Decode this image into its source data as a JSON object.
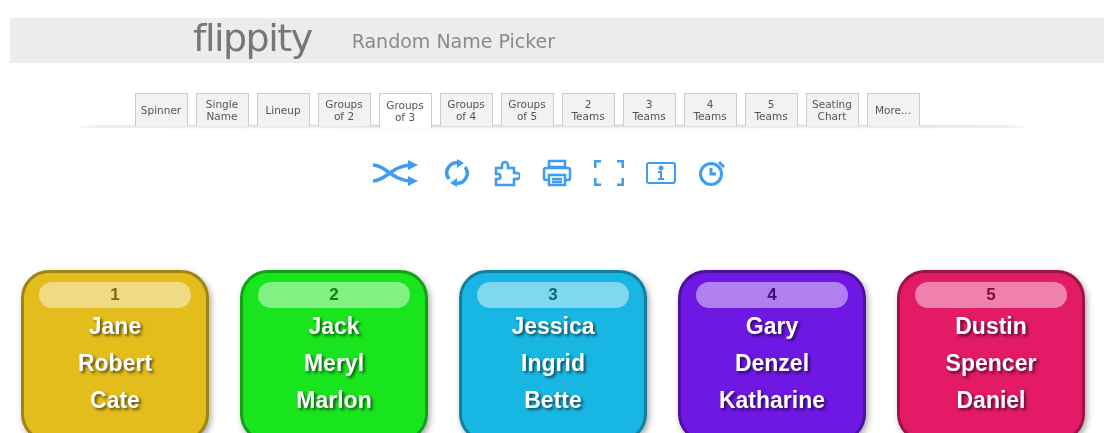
{
  "header": {
    "logo": "flippity",
    "title": "Random Name Picker"
  },
  "tabs": [
    {
      "label": "Spinner",
      "selected": false
    },
    {
      "label": "Single\nName",
      "selected": false
    },
    {
      "label": "Lineup",
      "selected": false
    },
    {
      "label": "Groups\nof 2",
      "selected": false
    },
    {
      "label": "Groups\nof 3",
      "selected": true
    },
    {
      "label": "Groups\nof 4",
      "selected": false
    },
    {
      "label": "Groups\nof 5",
      "selected": false
    },
    {
      "label": "2\nTeams",
      "selected": false
    },
    {
      "label": "3\nTeams",
      "selected": false
    },
    {
      "label": "4\nTeams",
      "selected": false
    },
    {
      "label": "5\nTeams",
      "selected": false
    },
    {
      "label": "Seating\nChart",
      "selected": false
    },
    {
      "label": "More...",
      "selected": false
    }
  ],
  "toolbar": [
    {
      "kind": "shuffle"
    },
    {
      "kind": "refresh"
    },
    {
      "kind": "puzzle"
    },
    {
      "kind": "print"
    },
    {
      "kind": "fullscreen"
    },
    {
      "kind": "info"
    },
    {
      "kind": "timer"
    }
  ],
  "groups": [
    {
      "number": "1",
      "color": "#e3bd1c",
      "names": [
        "Jane",
        "Robert",
        "Cate"
      ]
    },
    {
      "number": "2",
      "color": "#19e51f",
      "names": [
        "Jack",
        "Meryl",
        "Marlon"
      ]
    },
    {
      "number": "3",
      "color": "#18b7e3",
      "names": [
        "Jessica",
        "Ingrid",
        "Bette"
      ]
    },
    {
      "number": "4",
      "color": "#6f17e3",
      "names": [
        "Gary",
        "Denzel",
        "Katharine"
      ]
    },
    {
      "number": "5",
      "color": "#e31a66",
      "names": [
        "Dustin",
        "Spencer",
        "Daniel"
      ]
    }
  ]
}
